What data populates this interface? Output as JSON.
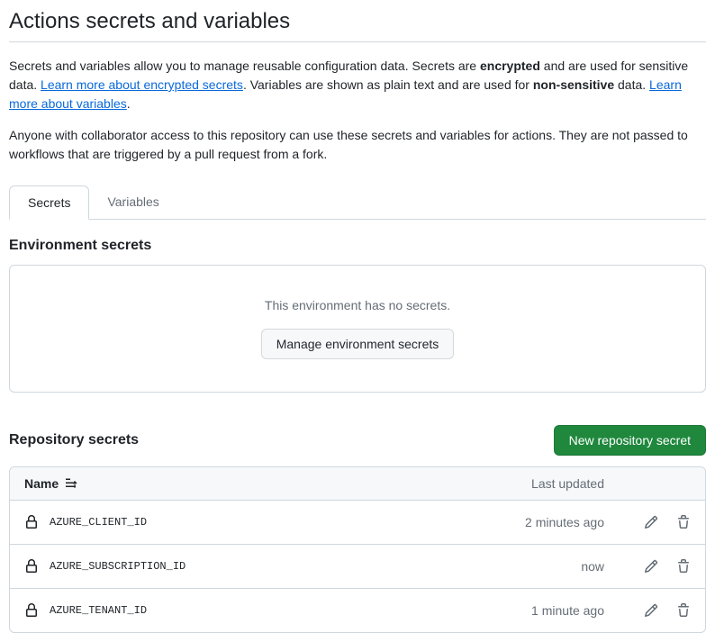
{
  "page": {
    "title": "Actions secrets and variables",
    "desc1_pre": "Secrets and variables allow you to manage reusable configuration data. Secrets are ",
    "desc1_strong": "encrypted",
    "desc1_mid": " and are used for sensitive data. ",
    "desc1_link": "Learn more about encrypted secrets",
    "desc1_post1": ". Variables are shown as plain text and are used for ",
    "desc1_strong2": "non-sensitive",
    "desc1_post2": " data. ",
    "desc1_link2": "Learn more about variables",
    "desc1_end": ".",
    "desc2": "Anyone with collaborator access to this repository can use these secrets and variables for actions. They are not passed to workflows that are triggered by a pull request from a fork."
  },
  "tabs": {
    "secrets": "Secrets",
    "variables": "Variables"
  },
  "env": {
    "title": "Environment secrets",
    "empty": "This environment has no secrets.",
    "manage_btn": "Manage environment secrets"
  },
  "repo": {
    "title": "Repository secrets",
    "new_btn": "New repository secret",
    "col_name": "Name",
    "col_updated": "Last updated",
    "rows": [
      {
        "name": "AZURE_CLIENT_ID",
        "updated": "2 minutes ago"
      },
      {
        "name": "AZURE_SUBSCRIPTION_ID",
        "updated": "now"
      },
      {
        "name": "AZURE_TENANT_ID",
        "updated": "1 minute ago"
      }
    ]
  }
}
